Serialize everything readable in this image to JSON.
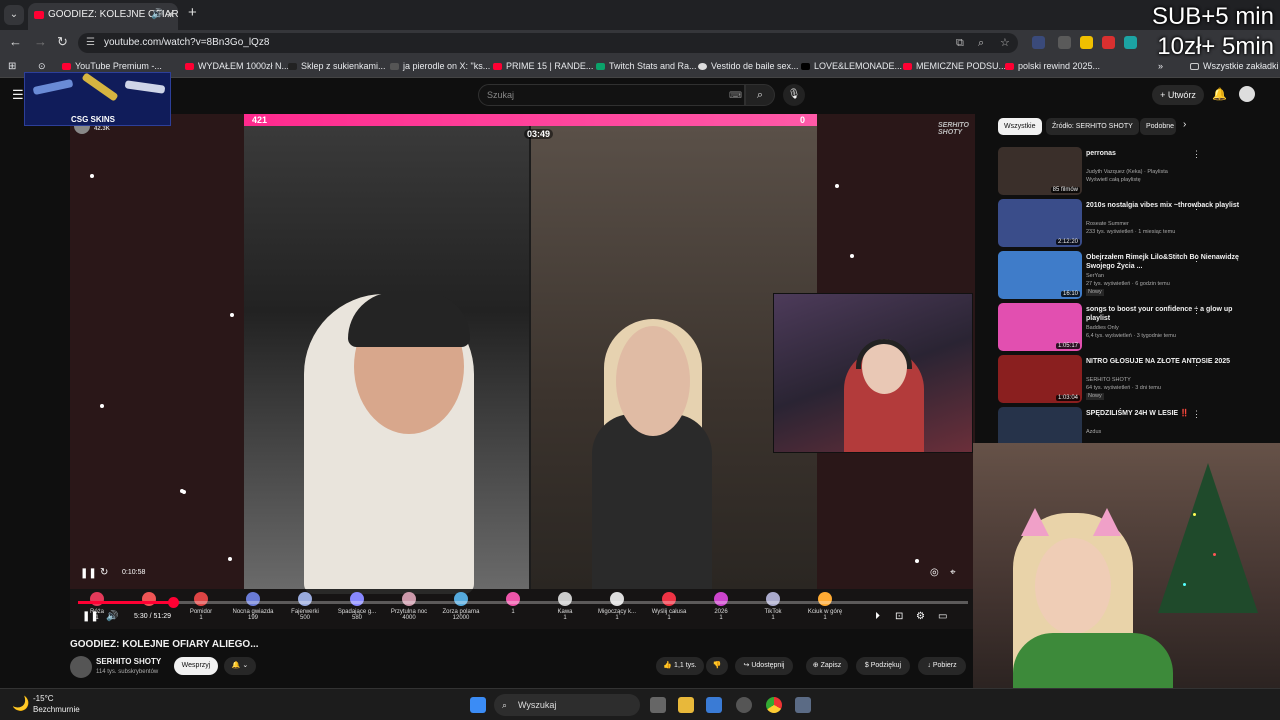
{
  "browser": {
    "tab_title": "GOODIEZ: KOLEJNE OFIARY",
    "url": "youtube.com/watch?v=8Bn3Go_lQz8",
    "bookmarks": [
      "YouTube Premium -...",
      "WYDAŁEM 1000zł N...",
      "Sklep z sukienkami...",
      "ja pierodle on X: \"ks...",
      "PRIME 15 | RANDE...",
      "Twitch Stats and Ra...",
      "Vestido de baile sex...",
      "LOVE&LEMONADE...",
      "MEMICZNE PODSU...",
      "polski rewind 2025..."
    ],
    "all_bookmarks": "Wszystkie zakładki"
  },
  "stream_overlay": {
    "line1": "SUB+5 min",
    "line2": "10zł+ 5min",
    "csg_label": "CSG SKINS"
  },
  "youtube": {
    "search_placeholder": "Szukaj",
    "create_label": "Utwórz",
    "player": {
      "hud_left": "421",
      "hud_timer": "03:49",
      "hud_right": "0",
      "viewer_count": "42.3K",
      "elapsed_overlay": "0:10:58",
      "time": "5:30 / 51:29",
      "progress": 0.107,
      "watermark": "SERHITO SHOTY"
    },
    "gifts": [
      {
        "name": "Róża",
        "cost": "1"
      },
      {
        "name": "",
        "cost": ""
      },
      {
        "name": "Pomidor",
        "cost": "1"
      },
      {
        "name": "Nocna gwiazda",
        "cost": "199"
      },
      {
        "name": "Fajerwerki",
        "cost": "500"
      },
      {
        "name": "Spadające g...",
        "cost": "580"
      },
      {
        "name": "Przytulna noc",
        "cost": "4000"
      },
      {
        "name": "Zorza polarna",
        "cost": "12000"
      },
      {
        "name": "",
        "cost": "1"
      },
      {
        "name": "Kawa",
        "cost": "1"
      },
      {
        "name": "Migoczący k...",
        "cost": "1"
      },
      {
        "name": "Wyślij całusa",
        "cost": "1"
      },
      {
        "name": "2026",
        "cost": "1"
      },
      {
        "name": "TikTok",
        "cost": "1"
      },
      {
        "name": "Kciuk w górę",
        "cost": "1"
      }
    ],
    "video_title": "GOODIEZ: KOLEJNE OFIARY ALIEGO...",
    "channel_name": "SERHITO SHOTY",
    "channel_subs": "114 tys. subskrybentów",
    "support_label": "Wesprzyj",
    "likes": "1,1 tys.",
    "share_label": "Udostępnij",
    "save_label": "Zapisz",
    "thanks_label": "Podziękuj",
    "download_label": "Pobierz"
  },
  "sidebar": {
    "chips": [
      "Wszystkie",
      "Źródło: SERHITO SHOTY",
      "Podobne"
    ],
    "recommendations": [
      {
        "title": "perronas",
        "meta1": "Judyth Vazquez (Keka) · Playlista",
        "meta2": "Wyświetl całą playlistę",
        "duration": "85 filmów",
        "color": "#3a2f2a"
      },
      {
        "title": "2010s nostalgia vibes mix ~throwback playlist",
        "meta1": "Roseate Summer",
        "meta2": "233 tys. wyświetleń · 1 miesiąc temu",
        "duration": "2:12:20",
        "color": "#3a4d8a"
      },
      {
        "title": "Obejrzałem Rimejk Lilo&Stitch Bo Nienawidzę Swojego Życia ...",
        "meta1": "SerYan",
        "meta2": "27 tys. wyświetleń · 6 godzin temu",
        "duration": "16:10",
        "color": "#3f7cc9",
        "badge": "Nowy"
      },
      {
        "title": "songs to boost your confidence ~ a glow up playlist",
        "meta1": "Baddies Only",
        "meta2": "6,4 tys. wyświetleń · 3 tygodnie temu",
        "duration": "1:05:17",
        "color": "#e24fb0"
      },
      {
        "title": "NITRO GŁOSUJE NA ZŁOTE ANTOSIE 2025",
        "meta1": "SERHITO SHOTY",
        "meta2": "64 tys. wyświetleń · 3 dni temu",
        "duration": "1:03:04",
        "color": "#8a1f1f",
        "badge": "Nowy"
      },
      {
        "title": "SPĘDZILIŚMY 24H W LESIE ‼️",
        "meta1": "Azdus",
        "meta2": "",
        "duration": "",
        "color": "#26334a"
      }
    ]
  },
  "taskbar": {
    "weather_temp": "-15°C",
    "weather_desc": "Bezchmurnie",
    "search_label": "Wyszukaj"
  }
}
